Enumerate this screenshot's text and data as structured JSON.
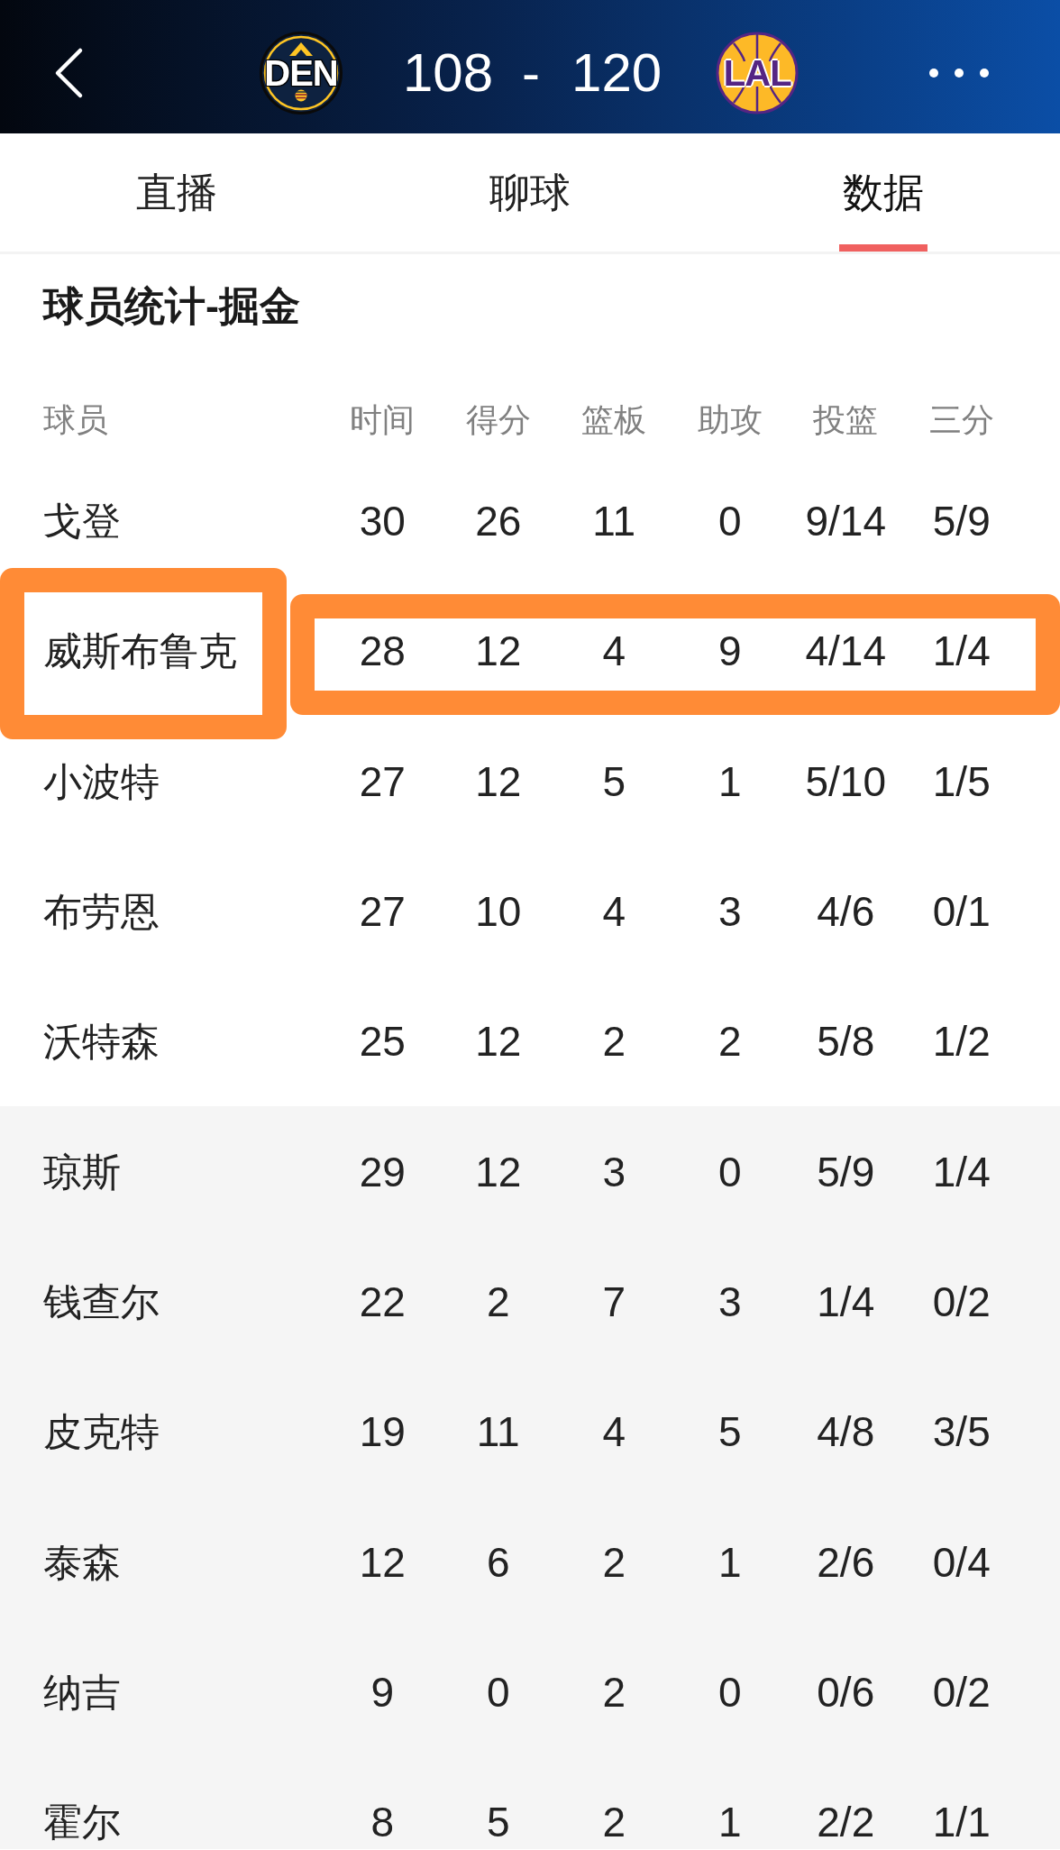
{
  "header": {
    "teams": [
      {
        "abbreviation": "DEN",
        "score": "108",
        "kind": "emblem"
      },
      {
        "abbreviation": "LAL",
        "score": "120",
        "kind": "ball"
      }
    ],
    "score_separator": "-"
  },
  "tabs": [
    {
      "label": "直播",
      "selected": false
    },
    {
      "label": "聊球",
      "selected": false
    },
    {
      "label": "数据",
      "selected": true
    }
  ],
  "section_title": "球员统计-掘金",
  "table": {
    "columns": [
      "球员",
      "时间",
      "得分",
      "篮板",
      "助攻",
      "投篮",
      "三分"
    ],
    "rows": [
      {
        "kind": "starter",
        "highlighted": false,
        "cells": [
          "戈登",
          "30",
          "26",
          "11",
          "0",
          "9/14",
          "5/9"
        ]
      },
      {
        "kind": "starter",
        "highlighted": true,
        "cells": [
          "威斯布鲁克",
          "28",
          "12",
          "4",
          "9",
          "4/14",
          "1/4"
        ]
      },
      {
        "kind": "starter",
        "highlighted": false,
        "cells": [
          "小波特",
          "27",
          "12",
          "5",
          "1",
          "5/10",
          "1/5"
        ]
      },
      {
        "kind": "starter",
        "highlighted": false,
        "cells": [
          "布劳恩",
          "27",
          "10",
          "4",
          "3",
          "4/6",
          "0/1"
        ]
      },
      {
        "kind": "starter",
        "highlighted": false,
        "cells": [
          "沃特森",
          "25",
          "12",
          "2",
          "2",
          "5/8",
          "1/2"
        ]
      },
      {
        "kind": "bench",
        "highlighted": false,
        "cells": [
          "琼斯",
          "29",
          "12",
          "3",
          "0",
          "5/9",
          "1/4"
        ]
      },
      {
        "kind": "bench",
        "highlighted": false,
        "cells": [
          "钱查尔",
          "22",
          "2",
          "7",
          "3",
          "1/4",
          "0/2"
        ]
      },
      {
        "kind": "bench",
        "highlighted": false,
        "cells": [
          "皮克特",
          "19",
          "11",
          "4",
          "5",
          "4/8",
          "3/5"
        ]
      },
      {
        "kind": "bench",
        "highlighted": false,
        "cells": [
          "泰森",
          "12",
          "6",
          "2",
          "1",
          "2/6",
          "0/4"
        ]
      },
      {
        "kind": "bench",
        "highlighted": false,
        "cells": [
          "纳吉",
          "9",
          "0",
          "2",
          "0",
          "0/6",
          "0/2"
        ]
      },
      {
        "kind": "bench",
        "highlighted": false,
        "cells": [
          "霍尔",
          "8",
          "5",
          "2",
          "1",
          "2/2",
          "1/1"
        ]
      }
    ]
  }
}
